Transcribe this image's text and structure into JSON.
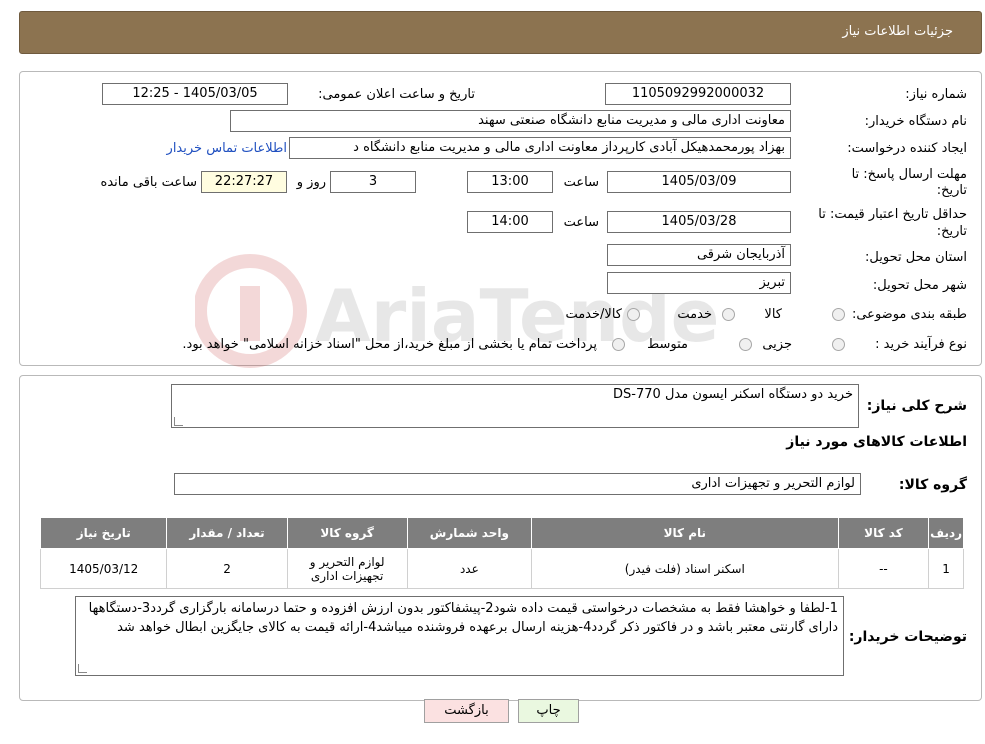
{
  "header": {
    "title": "جزئیات اطلاعات نیاز"
  },
  "fields": {
    "need_number_label": "شماره نیاز:",
    "need_number": "1105092992000032",
    "announce_label": "تاریخ و ساعت اعلان عمومی:",
    "announce_value": "1405/03/05 - 12:25",
    "buyer_org_label": "نام دستگاه خریدار:",
    "buyer_org": "معاونت اداری  مالی و مدیریت منابع دانشگاه صنعتی سهند",
    "creator_label": "ایجاد کننده درخواست:",
    "creator": "بهزاد پورمحمدهیکل آبادی کارپرداز معاونت اداری  مالی و مدیریت منابع دانشگاه د",
    "contact_link": "اطلاعات تماس خریدار",
    "deadline_label_1": "مهلت ارسال پاسخ: تا",
    "deadline_label_2": "تاریخ:",
    "deadline_date": "1405/03/09",
    "deadline_time_label": "ساعت",
    "deadline_time": "13:00",
    "days_value": "3",
    "days_label": "روز و",
    "remaining_time": "22:27:27",
    "remaining_label": "ساعت باقی مانده",
    "validity_label_1": "حداقل تاریخ اعتبار قیمت: تا",
    "validity_label_2": "تاریخ:",
    "validity_date": "1405/03/28",
    "validity_time_label": "ساعت",
    "validity_time": "14:00",
    "province_label": "استان محل تحویل:",
    "province": "آذربایجان شرقی",
    "city_label": "شهر محل تحویل:",
    "city": "تبریز",
    "category_label": "طبقه بندی موضوعی:",
    "category_options": [
      "کالا",
      "خدمت",
      "کالا/خدمت"
    ],
    "purchase_type_label": "نوع فرآیند خرید :",
    "purchase_options": [
      "جزیی",
      "متوسط"
    ],
    "purchase_note": "پرداخت تمام یا بخشی از مبلغ خرید،از محل \"اسناد خزانه اسلامی\" خواهد بود."
  },
  "summary": {
    "label": "شرح کلی نیاز:",
    "value": "خرید دو دستگاه اسکنر ایسون مدل DS-770",
    "goods_info_title": "اطلاعات کالاهای مورد نیاز",
    "group_label": "گروه کالا:",
    "group_value": "لوازم التحریر و تجهیزات اداری"
  },
  "table": {
    "headers": [
      "ردیف",
      "کد کالا",
      "نام کالا",
      "واحد شمارش",
      "گروه کالا",
      "تعداد / مقدار",
      "تاریخ نیاز"
    ],
    "rows": [
      {
        "row": "1",
        "code": "--",
        "name": "اسکنر اسناد (فلت فیدر)",
        "unit": "عدد",
        "group": "لوازم التحریر و تجهیزات اداری",
        "qty": "2",
        "date": "1405/03/12"
      }
    ]
  },
  "buyer_notes": {
    "label": "توضیحات خریدار:",
    "text": "1-لطفا و خواهشا فقط به مشخصات درخواستی قیمت داده شود2-پیشفاکتور بدون ارزش افزوده و حتما درسامانه بارگزاری گردد3-دستگاهها دارای گارنتی معتبر باشد و در فاکتور ذکر گردد4-هزینه ارسال برعهده فروشنده میباشد4-ارائه قیمت به کالای جایگزین ابطال خواهد شد"
  },
  "buttons": {
    "print": "چاپ",
    "back": "بازگشت"
  },
  "watermark": {
    "text": "AriaTender.neT"
  },
  "colors": {
    "header_bg": "#8c7350",
    "table_header_bg": "#7e7e7e",
    "print_btn": "#eaf8e0",
    "back_btn": "#fbe1e1",
    "link": "#2050c0"
  }
}
